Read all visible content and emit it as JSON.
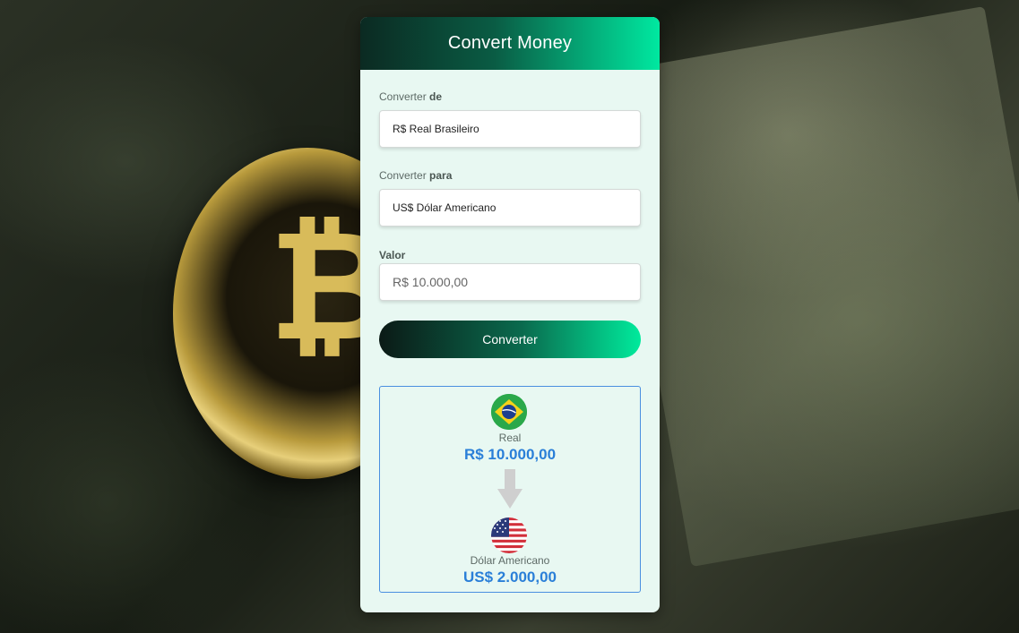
{
  "app": {
    "title": "Convert Money"
  },
  "form": {
    "from_label_prefix": "Converter ",
    "from_label_bold": "de",
    "from_value": "R$ Real Brasileiro",
    "to_label_prefix": "Converter ",
    "to_label_bold": "para",
    "to_value": "US$ Dólar Americano",
    "amount_label": "Valor",
    "amount_placeholder": "R$ 10.000,00",
    "convert_button": "Converter"
  },
  "result": {
    "from": {
      "icon": "brazil-flag-icon",
      "name": "Real",
      "value": "R$ 10.000,00"
    },
    "arrow_icon": "arrow-down-icon",
    "to": {
      "icon": "usa-flag-icon",
      "name": "Dólar Americano",
      "value": "US$ 2.000,00"
    }
  },
  "colors": {
    "accent": "#00e8a0",
    "header_dark": "#0b2a22",
    "card_bg": "#e8f8f2",
    "result_border": "#4a8fe0",
    "result_value": "#2a7fd8"
  }
}
